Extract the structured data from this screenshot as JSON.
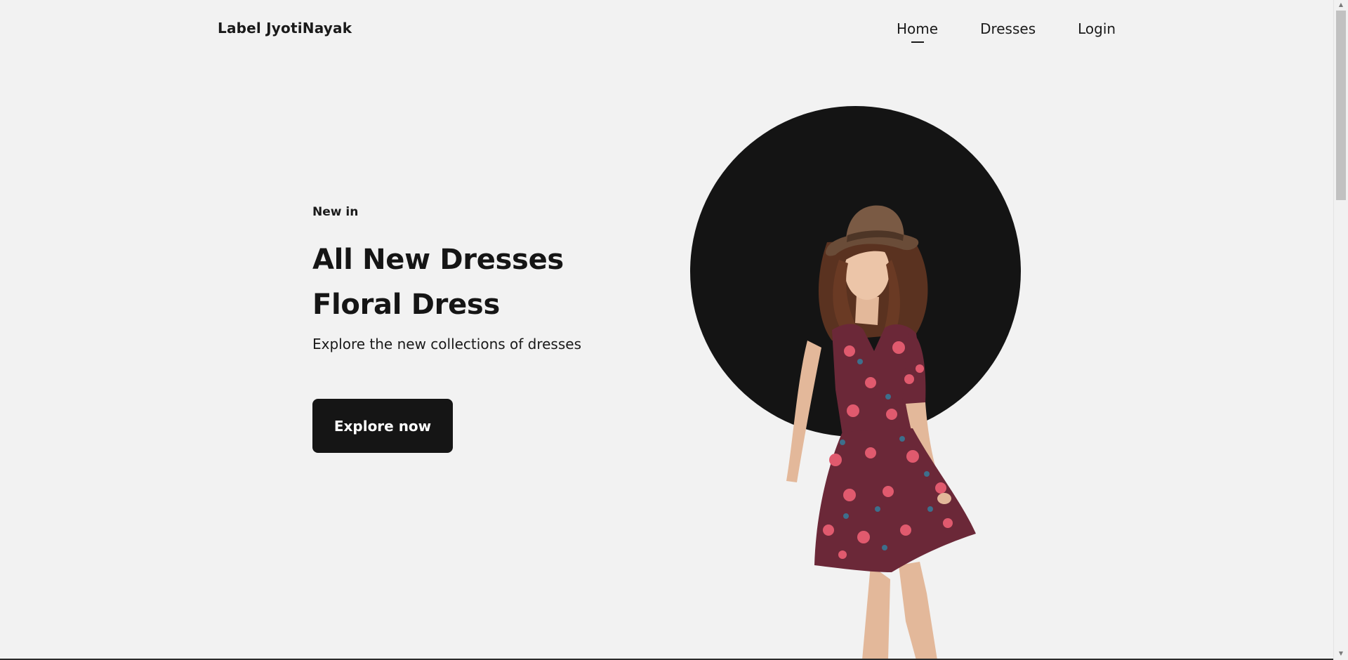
{
  "header": {
    "brand": "Label JyotiNayak",
    "nav": [
      {
        "label": "Home",
        "active": true
      },
      {
        "label": "Dresses",
        "active": false
      },
      {
        "label": "Login",
        "active": false
      }
    ]
  },
  "hero": {
    "eyebrow": "New in",
    "headline_line1": "All New Dresses",
    "headline_line2": "Floral Dress",
    "subtext": "Explore the new collections of dresses",
    "cta_label": "Explore now"
  },
  "colors": {
    "background": "#f2f2f2",
    "accent_dark": "#141414",
    "dress": "#6b2838",
    "flower_pink": "#e05a6e",
    "flower_blue": "#3d6f8c",
    "hat": "#7a5a44",
    "hair": "#5a3220",
    "skin": "#e9c2a4"
  },
  "icons": {
    "scroll_up": "▲",
    "scroll_down": "▼"
  }
}
